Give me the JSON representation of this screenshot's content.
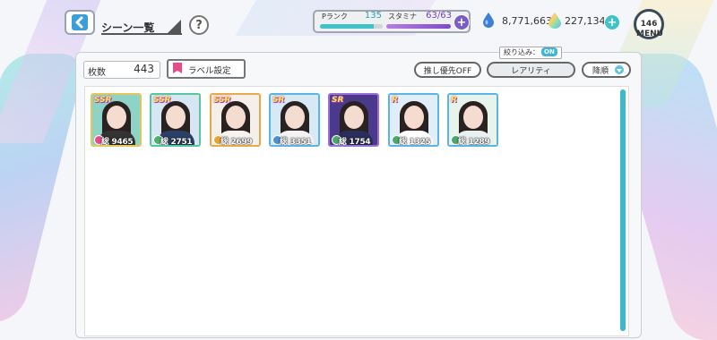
{
  "header": {
    "title": "シーン一覧",
    "help_label": "?"
  },
  "status": {
    "p_rank_label": "Pランク",
    "p_rank_value": "135",
    "p_rank_progress": 0.85,
    "stamina_label": "スタミナ",
    "stamina_value": "63/63",
    "stamina_progress": 1.0,
    "plus_label": "+"
  },
  "currency": {
    "drops": "8,771,663",
    "rainbow": "227,134",
    "plus_label": "+"
  },
  "menu": {
    "badge": "146",
    "label": "MENU"
  },
  "toolbar": {
    "count_label": "枚数",
    "count_value": "443",
    "label_settings": "ラベル設定",
    "filter_label": "絞り込み：",
    "filter_state": "ON",
    "oshi_priority": "推し優先OFF",
    "rarity": "レアリティ",
    "sort": "降順"
  },
  "cards": [
    {
      "rarity": "SSR",
      "power": "総 9465",
      "frame": "#e2c75a",
      "attr": "#e94b8a",
      "bg": "#8fd3c7",
      "body": "#333"
    },
    {
      "rarity": "SSR",
      "power": "総 2751",
      "frame": "#54c7a0",
      "attr": "#49b36b",
      "bg": "#d6e6f2",
      "body": "#2a4066"
    },
    {
      "rarity": "SSR",
      "power": "総 2699",
      "frame": "#e8a94a",
      "attr": "#e8a232",
      "bg": "#f4efe8",
      "body": "#f6f2ee"
    },
    {
      "rarity": "SR",
      "power": "総 3351",
      "frame": "#5ab4e6",
      "attr": "#4a8fd8",
      "bg": "#d7e9f5",
      "body": "#f3f3f3"
    },
    {
      "rarity": "SR",
      "power": "総 1754",
      "frame": "#9a70d8",
      "attr": "#4aa86c",
      "bg": "#4b3a8c",
      "body": "#2b2e5a"
    },
    {
      "rarity": "R",
      "power": "総 1325",
      "frame": "#5ab4e6",
      "attr": "#4aa86c",
      "bg": "#dfeef8",
      "body": "#ffffff"
    },
    {
      "rarity": "R",
      "power": "総 1289",
      "frame": "#5ab4e6",
      "attr": "#4aa86c",
      "bg": "#e7f4ec",
      "body": "#e9f0f2"
    }
  ]
}
